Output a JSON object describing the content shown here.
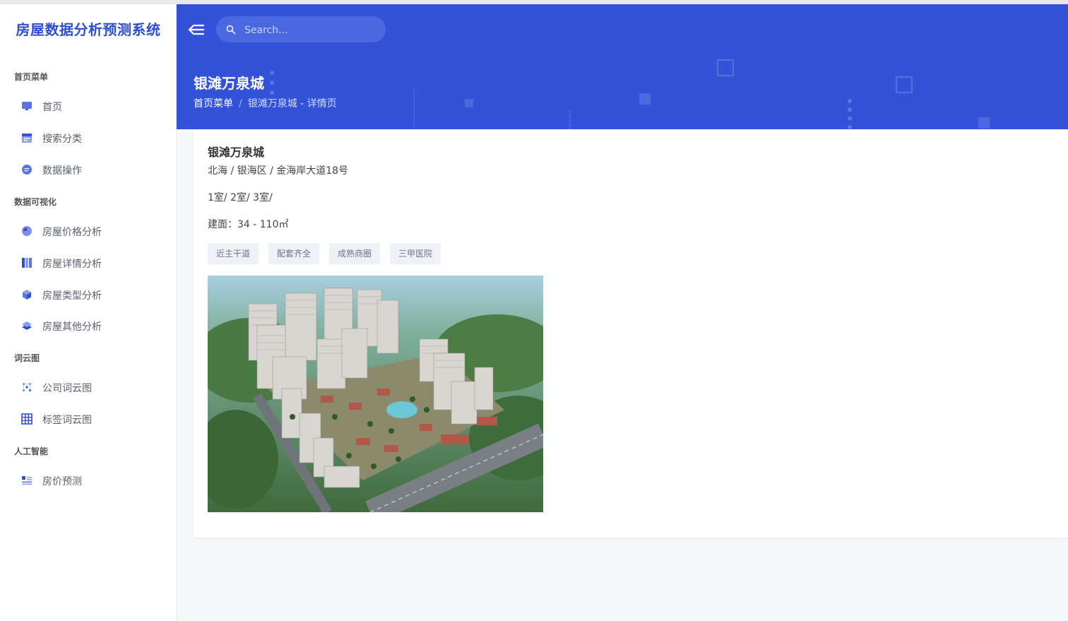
{
  "app": {
    "title": "房屋数据分析预测系统"
  },
  "sidebar": {
    "sections": [
      {
        "title": "首页菜单",
        "items": [
          {
            "label": "首页",
            "icon": "monitor-icon"
          },
          {
            "label": "搜索分类",
            "icon": "calendar-icon"
          },
          {
            "label": "数据操作",
            "icon": "chat-icon"
          }
        ]
      },
      {
        "title": "数据可视化",
        "items": [
          {
            "label": "房屋价格分析",
            "icon": "pie-icon"
          },
          {
            "label": "房屋详情分析",
            "icon": "columns-icon"
          },
          {
            "label": "房屋类型分析",
            "icon": "cube-icon"
          },
          {
            "label": "房屋其他分析",
            "icon": "layers-icon"
          }
        ]
      },
      {
        "title": "词云图",
        "items": [
          {
            "label": "公司词云图",
            "icon": "scatter-icon"
          },
          {
            "label": "标签词云图",
            "icon": "grid-icon"
          }
        ]
      },
      {
        "title": "人工智能",
        "items": [
          {
            "label": "房价预测",
            "icon": "list-icon"
          }
        ]
      }
    ]
  },
  "header": {
    "search_placeholder": "Search...",
    "page_title": "银滩万泉城",
    "breadcrumb": {
      "root": "首页菜单",
      "separator": "/",
      "current": "银滩万泉城 - 详情页"
    }
  },
  "detail": {
    "name": "银滩万泉城",
    "location": "北海 / 银海区 / 金海岸大道18号",
    "rooms": "1室/ 2室/ 3室/",
    "area": "建面：34 - 110㎡",
    "tags": [
      "近主干道",
      "配套齐全",
      "成熟商圈",
      "三甲医院"
    ]
  },
  "colors": {
    "primary": "#3253d8",
    "sidebar_bg": "#ffffff",
    "page_bg": "#f4f6f8"
  }
}
